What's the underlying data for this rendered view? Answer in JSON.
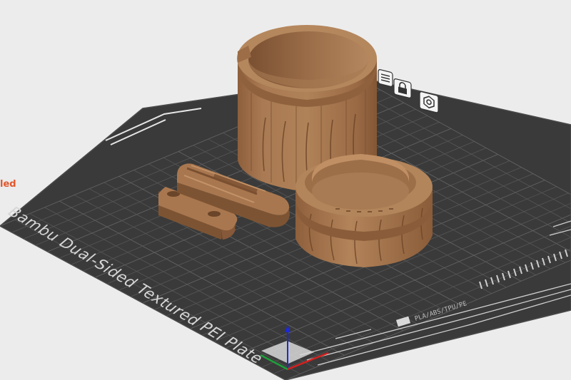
{
  "viewport": {
    "plate_name": "Bambu Dual-Sided Textured PEI Plate",
    "brand_text": "led",
    "filament_text": "PLA/ABS/TPU/PE",
    "colors": {
      "background": "#ececec",
      "plate": "#3a3a3a",
      "grid_line": "#575757",
      "model": "#a9774f",
      "brand_accent": "#e2572b",
      "axis_x": "#d42020",
      "axis_y": "#1fa03a",
      "axis_z": "#1c2ad6"
    }
  },
  "plate_tools": [
    {
      "name": "plate-list-icon"
    },
    {
      "name": "lock-icon"
    },
    {
      "name": "settings-icon"
    }
  ]
}
